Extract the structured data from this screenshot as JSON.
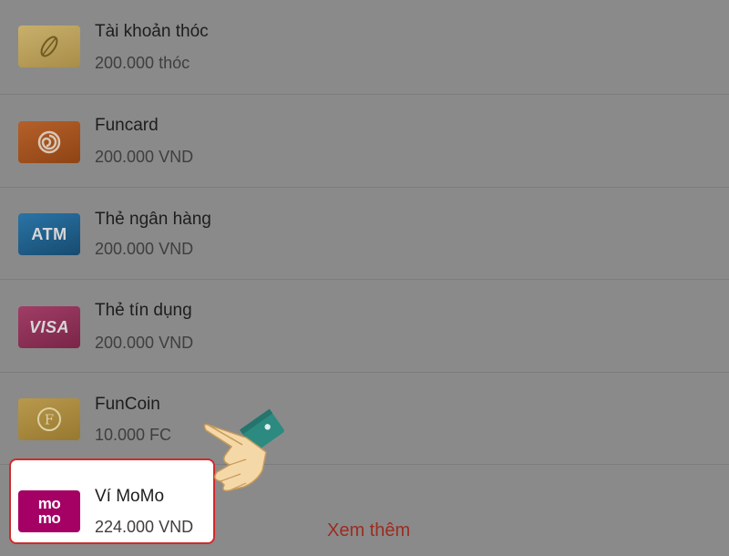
{
  "wallet_options": [
    {
      "icon": "rice-grain-icon",
      "icon_text": "",
      "title": "Tài khoản thóc",
      "balance": "200.000 thóc"
    },
    {
      "icon": "funcard-swirl-icon",
      "icon_text": "",
      "title": "Funcard",
      "balance": "200.000 VND"
    },
    {
      "icon": "atm-card-icon",
      "icon_text": "ATM",
      "title": "Thẻ ngân hàng",
      "balance": "200.000 VND"
    },
    {
      "icon": "visa-card-icon",
      "icon_text": "VISA",
      "title": "Thẻ tín dụng",
      "balance": "200.000 VND"
    },
    {
      "icon": "funcoin-icon",
      "icon_text": "F",
      "title": "FunCoin",
      "balance": "10.000 FC"
    },
    {
      "icon": "momo-logo-icon",
      "icon_text": "mo mo",
      "title": "Ví MoMo",
      "balance": "224.000 VND"
    }
  ],
  "see_more_label": "Xem thêm",
  "pointer": {
    "icon": "pointing-hand-icon"
  },
  "colors": {
    "overlay": "#8a8a8a",
    "highlight_border": "#d12a2a",
    "see_more": "#9c2c1f",
    "rice_icon_bg": "#b8a160",
    "funcard_icon_bg": "#a4531c",
    "atm_icon_bg": "#1f5f8c",
    "visa_icon_bg": "#8b3156",
    "funcoin_icon_bg": "#a88a3e",
    "momo_icon_bg": "#a50064"
  }
}
